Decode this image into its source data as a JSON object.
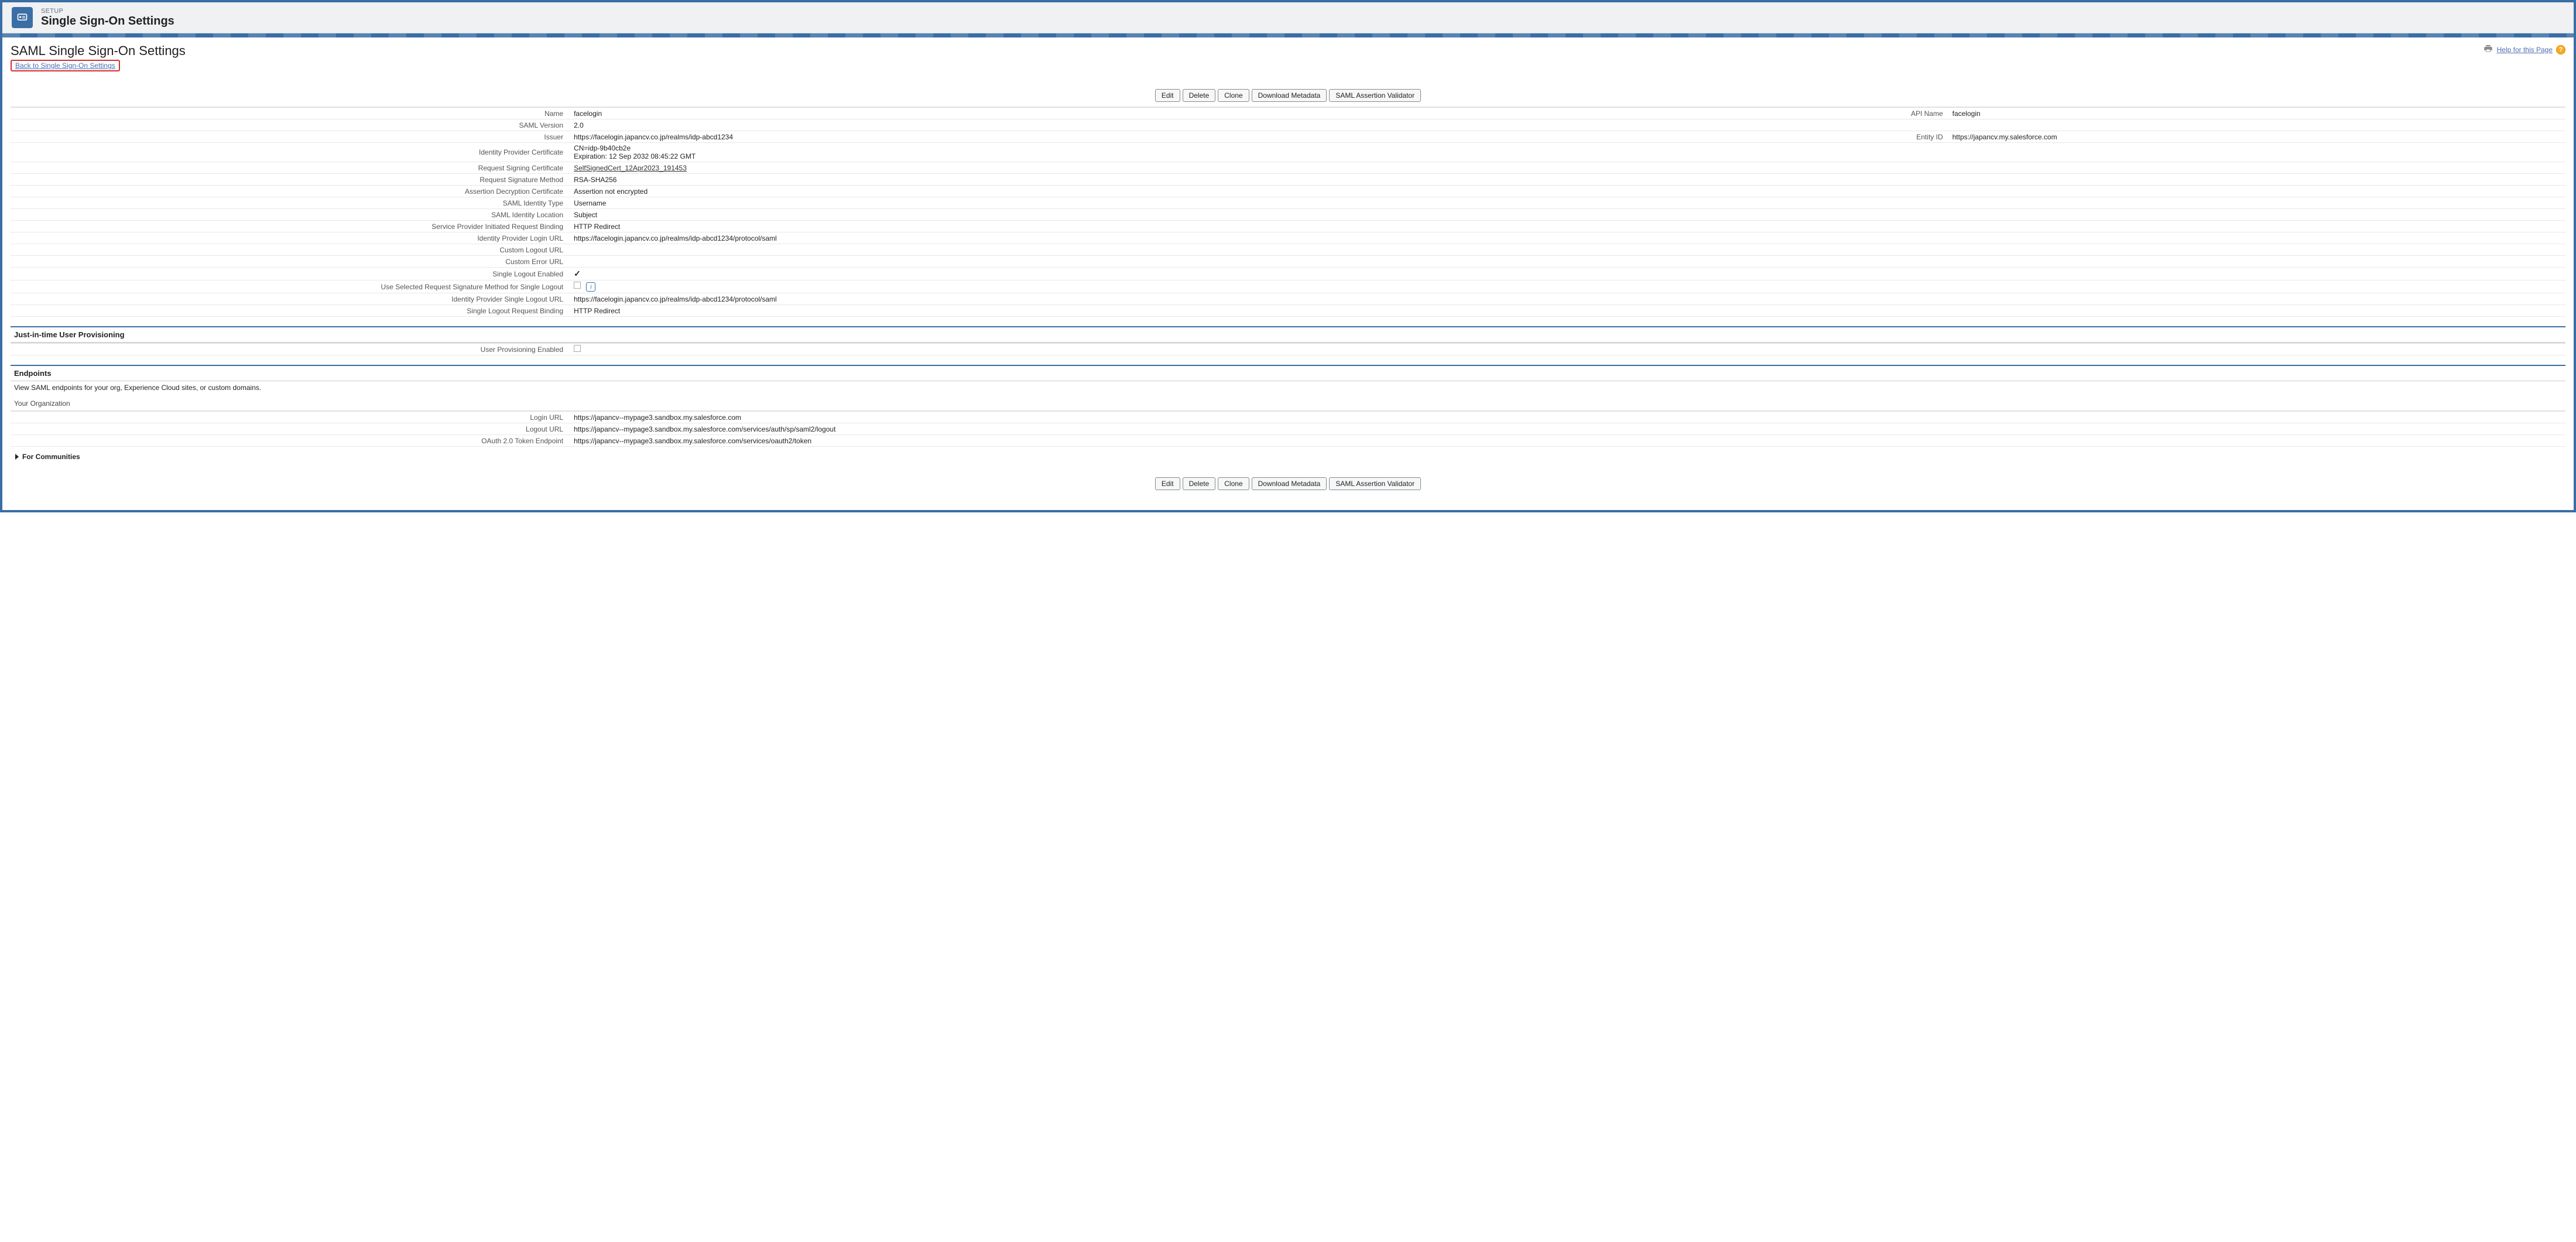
{
  "header": {
    "sup": "SETUP",
    "title": "Single Sign-On Settings"
  },
  "page": {
    "heading": "SAML Single Sign-On Settings",
    "back_link": "Back to Single Sign-On Settings",
    "help": "Help for this Page"
  },
  "buttons": {
    "edit": "Edit",
    "delete": "Delete",
    "clone": "Clone",
    "download_metadata": "Download Metadata",
    "saml_validator": "SAML Assertion Validator"
  },
  "fields": {
    "name_label": "Name",
    "name_value": "facelogin",
    "api_name_label": "API Name",
    "api_name_value": "facelogin",
    "saml_version_label": "SAML Version",
    "saml_version_value": "2.0",
    "issuer_label": "Issuer",
    "issuer_value": "https://facelogin.japancv.co.jp/realms/idp-abcd1234",
    "entity_id_label": "Entity ID",
    "entity_id_value": "https://japancv.my.salesforce.com",
    "idp_cert_label": "Identity Provider Certificate",
    "idp_cert_value_line1": "CN=idp-9b40cb2e",
    "idp_cert_value_line2": "Expiration: 12 Sep 2032 08:45:22 GMT",
    "req_sign_cert_label": "Request Signing Certificate",
    "req_sign_cert_value": "SelfSignedCert_12Apr2023_191453",
    "req_sig_method_label": "Request Signature Method",
    "req_sig_method_value": "RSA-SHA256",
    "assertion_decrypt_label": "Assertion Decryption Certificate",
    "assertion_decrypt_value": "Assertion not encrypted",
    "saml_identity_type_label": "SAML Identity Type",
    "saml_identity_type_value": "Username",
    "saml_identity_loc_label": "SAML Identity Location",
    "saml_identity_loc_value": "Subject",
    "sp_binding_label": "Service Provider Initiated Request Binding",
    "sp_binding_value": "HTTP Redirect",
    "idp_login_url_label": "Identity Provider Login URL",
    "idp_login_url_value": "https://facelogin.japancv.co.jp/realms/idp-abcd1234/protocol/saml",
    "custom_logout_url_label": "Custom Logout URL",
    "custom_logout_url_value": "",
    "custom_error_url_label": "Custom Error URL",
    "custom_error_url_value": "",
    "single_logout_enabled_label": "Single Logout Enabled",
    "use_sel_req_sig_label": "Use Selected Request Signature Method for Single Logout",
    "idp_slo_url_label": "Identity Provider Single Logout URL",
    "idp_slo_url_value": "https://facelogin.japancv.co.jp/realms/idp-abcd1234/protocol/saml",
    "slo_binding_label": "Single Logout Request Binding",
    "slo_binding_value": "HTTP Redirect"
  },
  "jit": {
    "header": "Just-in-time User Provisioning",
    "enabled_label": "User Provisioning Enabled"
  },
  "endpoints": {
    "header": "Endpoints",
    "desc": "View SAML endpoints for your org, Experience Cloud sites, or custom domains.",
    "org_header": "Your Organization",
    "login_url_label": "Login URL",
    "login_url_value": "https://japancv--mypage3.sandbox.my.salesforce.com",
    "logout_url_label": "Logout URL",
    "logout_url_value": "https://japancv--mypage3.sandbox.my.salesforce.com/services/auth/sp/saml2/logout",
    "oauth_label": "OAuth 2.0 Token Endpoint",
    "oauth_value": "https://japancv--mypage3.sandbox.my.salesforce.com/services/oauth2/token"
  },
  "communities": {
    "label": "For Communities"
  }
}
